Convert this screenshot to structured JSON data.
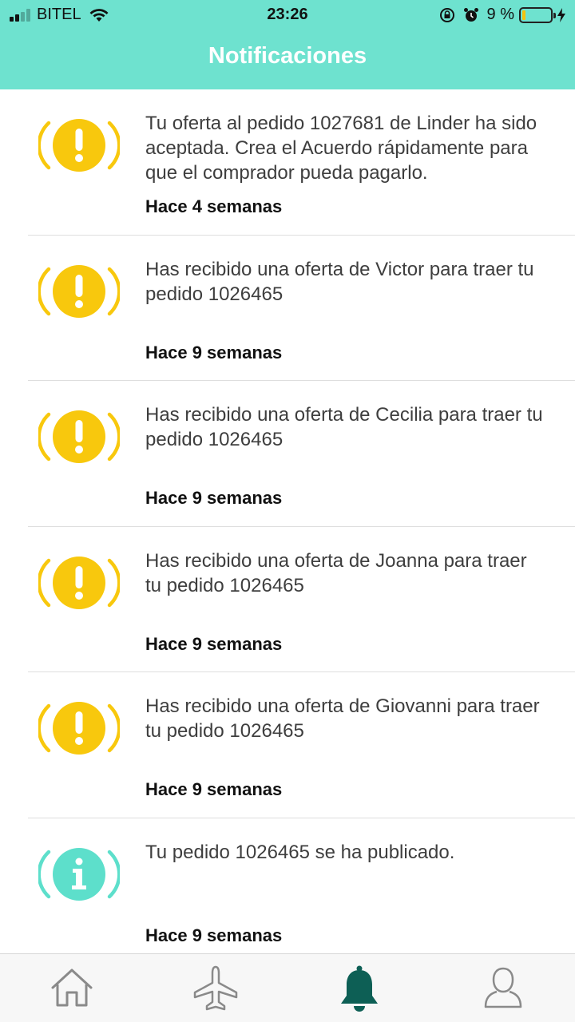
{
  "status_bar": {
    "carrier": "BITEL",
    "time": "23:26",
    "battery_percent": "9 %",
    "icons": [
      "signal-icon",
      "wifi-icon",
      "orientation-lock-icon",
      "alarm-icon",
      "battery-icon",
      "charging-icon"
    ]
  },
  "header": {
    "title": "Notificaciones",
    "background": "#6ee2cf"
  },
  "colors": {
    "warning": "#f8c80d",
    "info": "#5ddfcb",
    "active_tab": "#0d5f55",
    "inactive_tab": "#8a8a8a"
  },
  "notifications": [
    {
      "icon": "warning-icon",
      "text": "Tu oferta al pedido 1027681 de Linder ha sido aceptada. Crea el Acuerdo rápidamente para que el comprador pueda pagarlo.",
      "time": "Hace 4 semanas"
    },
    {
      "icon": "warning-icon",
      "text": "Has recibido una oferta de Victor para traer tu pedido 1026465",
      "time": "Hace 9 semanas"
    },
    {
      "icon": "warning-icon",
      "text": "Has recibido una oferta de Cecilia para traer tu pedido 1026465",
      "time": "Hace 9 semanas"
    },
    {
      "icon": "warning-icon",
      "text": "Has recibido una oferta de Joanna para traer tu pedido 1026465",
      "time": "Hace 9 semanas"
    },
    {
      "icon": "warning-icon",
      "text": "Has recibido una oferta de Giovanni para traer tu pedido 1026465",
      "time": "Hace 9 semanas"
    },
    {
      "icon": "info-icon",
      "text": "Tu pedido 1026465 se ha publicado.",
      "time": "Hace 9 semanas"
    }
  ],
  "tabbar": {
    "tabs": [
      {
        "icon": "home-icon",
        "active": false
      },
      {
        "icon": "airplane-icon",
        "active": false
      },
      {
        "icon": "bell-icon",
        "active": true
      },
      {
        "icon": "profile-icon",
        "active": false
      }
    ]
  }
}
